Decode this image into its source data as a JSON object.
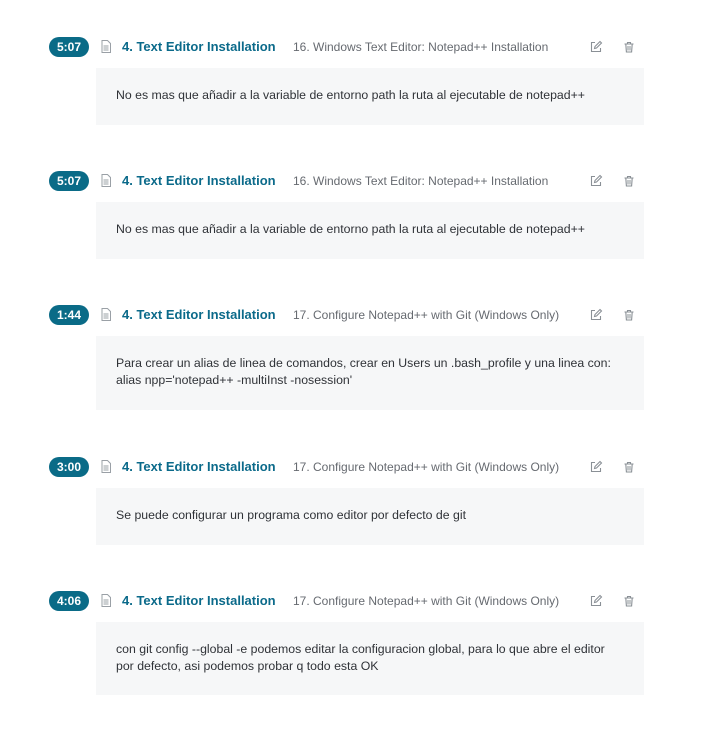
{
  "notes": [
    {
      "timestamp": "5:07",
      "section": "4. Text Editor Installation",
      "lecture": "16. Windows Text Editor: Notepad++ Installation",
      "text": "No es mas que añadir a la variable de entorno path la ruta al ejecutable de notepad++"
    },
    {
      "timestamp": "5:07",
      "section": "4. Text Editor Installation",
      "lecture": "16. Windows Text Editor: Notepad++ Installation",
      "text": "No es mas que añadir a la variable de entorno path la ruta al ejecutable de notepad++"
    },
    {
      "timestamp": "1:44",
      "section": "4. Text Editor Installation",
      "lecture": "17. Configure Notepad++ with Git (Windows Only)",
      "text": "Para crear un alias de linea de comandos, crear en Users un .bash_profile y una linea con: alias npp='notepad++ -multiInst -nosession'"
    },
    {
      "timestamp": "3:00",
      "section": "4. Text Editor Installation",
      "lecture": "17. Configure Notepad++ with Git (Windows Only)",
      "text": "Se puede configurar un programa como editor por defecto de git"
    },
    {
      "timestamp": "4:06",
      "section": "4. Text Editor Installation",
      "lecture": "17. Configure Notepad++ with Git (Windows Only)",
      "text": "con git config --global -e podemos editar la configuracion global, para lo que abre el editor por defecto, asi podemos probar q todo esta OK"
    }
  ],
  "icons": {
    "lecture": "document-icon",
    "edit": "edit-icon",
    "delete": "trash-icon"
  },
  "colors": {
    "badge": "#0a6b87",
    "section": "#0b6a8a",
    "note_background": "#f6f7f8"
  }
}
